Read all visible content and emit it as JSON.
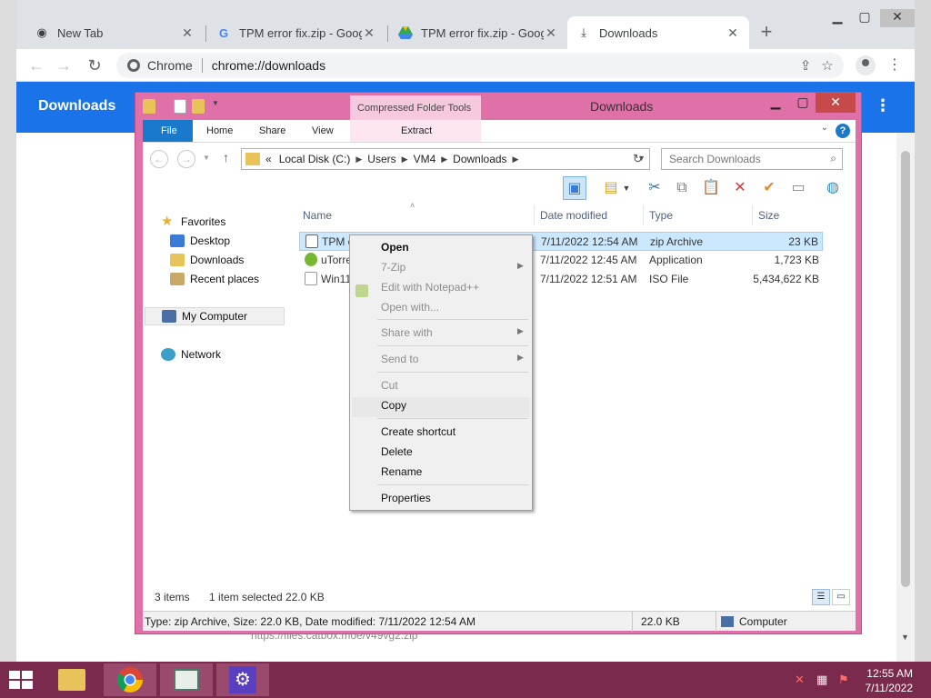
{
  "browser": {
    "tabs": [
      {
        "title": "New Tab",
        "icon": "chrome-icon"
      },
      {
        "title": "TPM error fix.zip - Google Drive",
        "icon": "google-g-icon"
      },
      {
        "title": "TPM error fix.zip - Google Drive",
        "icon": "drive-icon"
      },
      {
        "title": "Downloads",
        "icon": "download-icon"
      }
    ],
    "omnibox": {
      "chip": "Chrome",
      "url": "chrome://downloads"
    },
    "page_title": "Downloads",
    "behind_url": "https://files.catbox.moe/v49vg2.zip"
  },
  "explorer": {
    "title": "Downloads",
    "context_tab_group": "Compressed Folder Tools",
    "ribbon_tabs": [
      "File",
      "Home",
      "Share",
      "View",
      "Extract"
    ],
    "address_path": [
      "Local Disk (C:)",
      "Users",
      "VM4",
      "Downloads"
    ],
    "address_prefix": "«",
    "search_placeholder": "Search Downloads",
    "nav": {
      "favorites": "Favorites",
      "favorites_items": [
        "Desktop",
        "Downloads",
        "Recent places"
      ],
      "my_computer": "My Computer",
      "network": "Network"
    },
    "columns": [
      "Name",
      "Date modified",
      "Type",
      "Size"
    ],
    "files": [
      {
        "name": "TPM error fix",
        "date": "7/11/2022 12:54 AM",
        "type": "zip Archive",
        "size": "23 KB",
        "selected": true
      },
      {
        "name": "uTorrent",
        "date": "7/11/2022 12:45 AM",
        "type": "Application",
        "size": "1,723 KB",
        "selected": false
      },
      {
        "name": "Win11_English_x64v1",
        "date": "7/11/2022 12:51 AM",
        "type": "ISO File",
        "size": "5,434,622 KB",
        "selected": false
      }
    ],
    "status": {
      "items": "3 items",
      "selected": "1 item selected  22.0 KB"
    },
    "details": {
      "info": "Type: zip Archive, Size: 22.0 KB, Date modified: 7/11/2022 12:54 AM",
      "size": "22.0 KB",
      "location": "Computer"
    }
  },
  "context_menu": {
    "open": "Open",
    "seven_zip": "7-Zip",
    "notepad": "Edit with Notepad++",
    "open_with": "Open with...",
    "share_with": "Share with",
    "send_to": "Send to",
    "cut": "Cut",
    "copy": "Copy",
    "create_shortcut": "Create shortcut",
    "delete": "Delete",
    "rename": "Rename",
    "properties": "Properties"
  },
  "taskbar": {
    "time": "12:55 AM",
    "date": "7/11/2022"
  },
  "colors": {
    "chrome_header": "#1a73e8",
    "explorer_frame": "#e070a8",
    "taskbar": "#7a2a4d",
    "selection": "#cce8ff"
  }
}
